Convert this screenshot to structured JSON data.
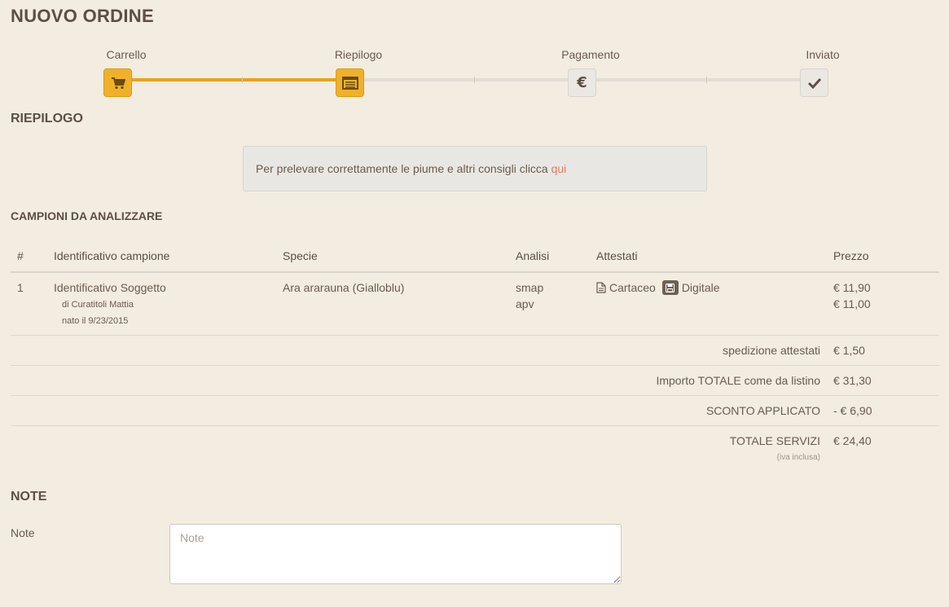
{
  "page_title": "NUOVO ORDINE",
  "stepper": {
    "steps": [
      {
        "label": "Carrello",
        "icon": "cart-icon",
        "state": "active"
      },
      {
        "label": "Riepilogo",
        "icon": "list-icon",
        "state": "active"
      },
      {
        "label": "Pagamento",
        "icon": "euro-icon",
        "state": "inactive"
      },
      {
        "label": "Inviato",
        "icon": "check-icon",
        "state": "inactive"
      }
    ]
  },
  "riepilogo": {
    "title": "RIEPILOGO",
    "info_text": "Per prelevare correttamente le piume e altri consigli clicca ",
    "info_link": "qui"
  },
  "campioni": {
    "title": "CAMPIONI DA ANALIZZARE",
    "headers": [
      "#",
      "Identificativo campione",
      "Specie",
      "Analisi",
      "Attestati",
      "Prezzo"
    ],
    "rows": [
      {
        "num": "1",
        "identificativo": "Identificativo Soggetto",
        "owner": "di Curatitoli Mattia",
        "born": "nato il 9/23/2015",
        "specie": "Ara ararauna (Gialloblu)",
        "analisi": [
          "smap",
          "apv"
        ],
        "attestati": [
          "Cartaceo",
          "Digitale"
        ],
        "prezzi": [
          "€ 11,90",
          "€ 11,00"
        ]
      }
    ],
    "totals": [
      {
        "label": "spedizione attestati",
        "value": "€ 1,50"
      },
      {
        "label": "Importo TOTALE come da listino",
        "value": "€ 31,30"
      },
      {
        "label": "SCONTO APPLICATO",
        "value": "- € 6,90"
      },
      {
        "label": "TOTALE SERVIZI",
        "value": "€ 24,40",
        "note": "(iva inclusa)"
      }
    ]
  },
  "note": {
    "title": "NOTE",
    "label": "Note",
    "placeholder": "Note"
  },
  "colors": {
    "background": "#f3ece0",
    "accent": "#f0b12a",
    "link": "#e07a5f"
  }
}
